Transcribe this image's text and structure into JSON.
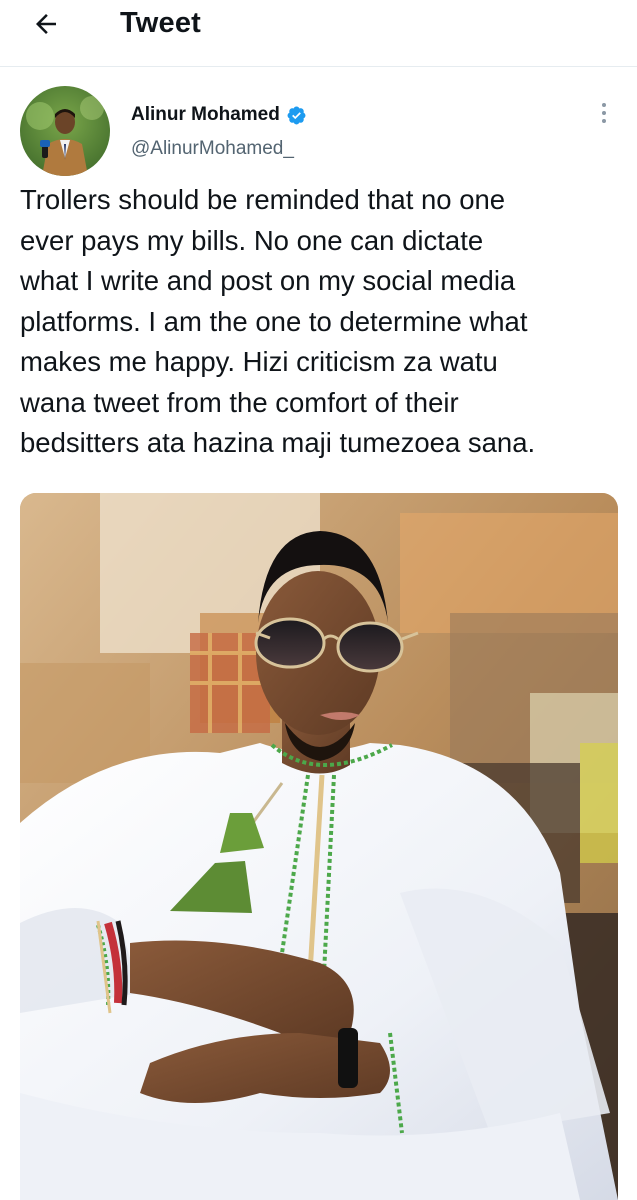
{
  "header": {
    "back_icon": "arrow-left-icon",
    "title": "Tweet"
  },
  "tweet": {
    "author": {
      "name": "Alinur Mohamed",
      "handle": "@AlinurMohamed_",
      "verified": true,
      "avatar_icon": "avatar-photo"
    },
    "more_icon": "more-vertical-icon",
    "text": "Trollers should be reminded that no one\never pays my bills. No one can  dictate\nwhat I write and post on my social media\nplatforms. I am the one to determine what\nmakes me happy. Hizi criticism za watu\nwana tweet from the comfort of their\nbedsitters ata hazina maji tumezoea sana.",
    "media": {
      "type": "photo",
      "description_icon": "photo-man-in-white-kanzu-sunglasses"
    }
  },
  "colors": {
    "verified": "#1d9bf0",
    "handle": "#536471",
    "text": "#0f1419",
    "divider": "#e6ecf0"
  }
}
